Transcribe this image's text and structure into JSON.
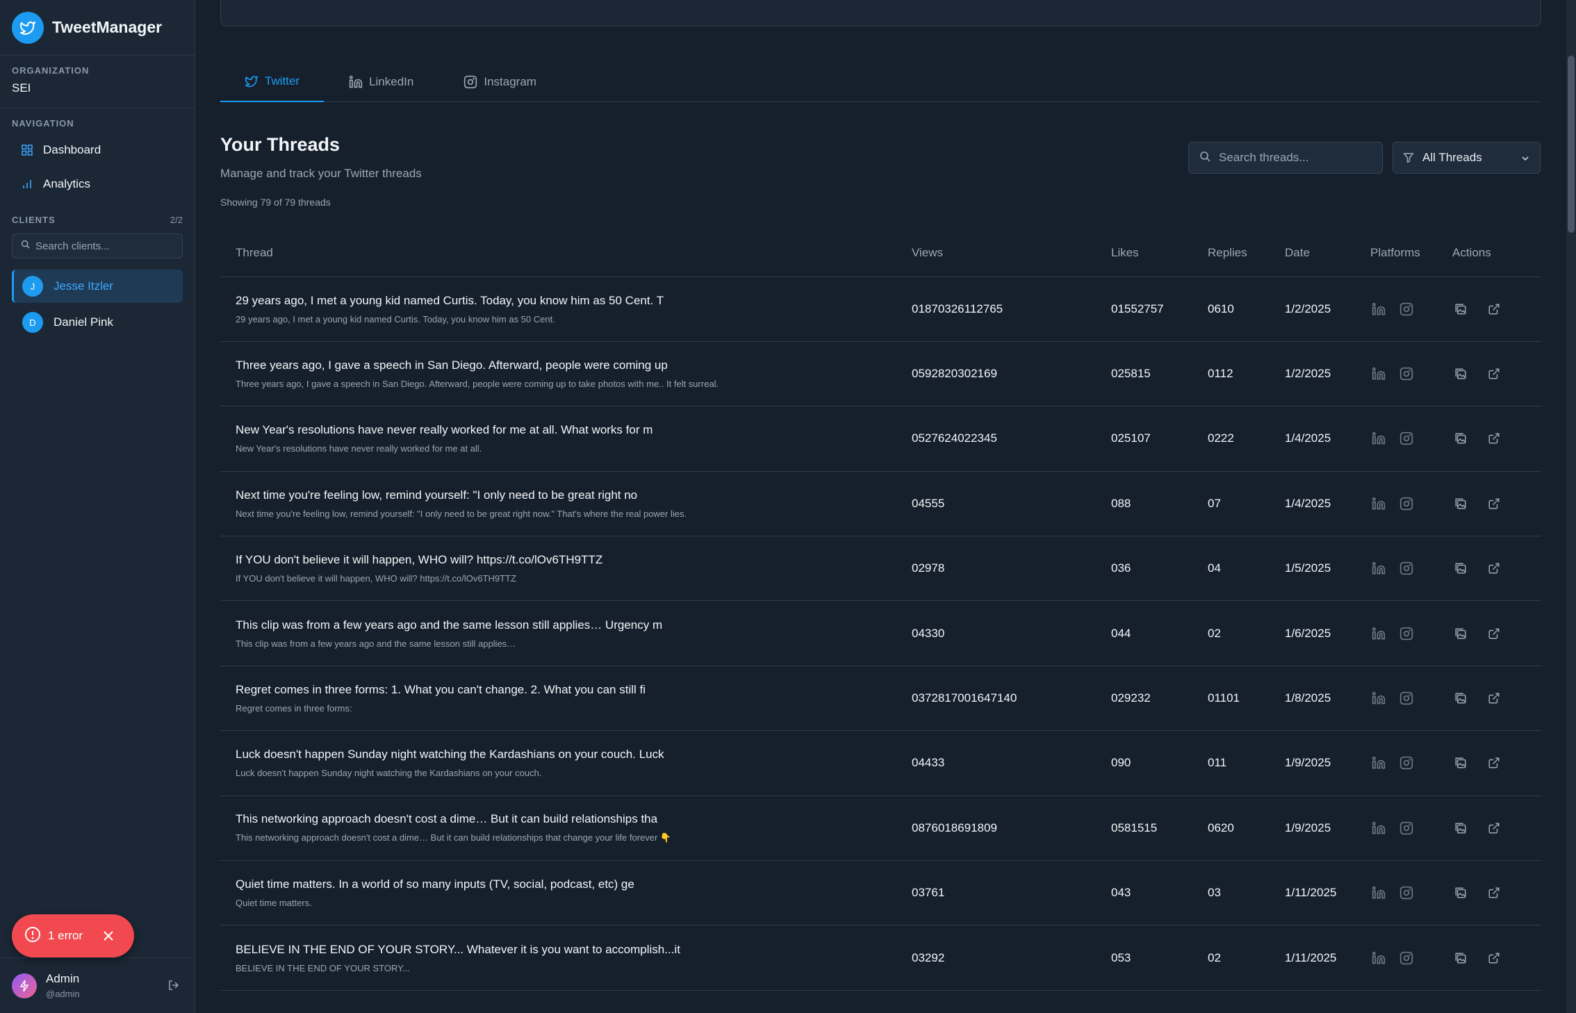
{
  "app": {
    "title": "TweetManager"
  },
  "organization": {
    "label": "ORGANIZATION",
    "name": "SEI"
  },
  "navigation": {
    "label": "NAVIGATION",
    "items": [
      {
        "label": "Dashboard",
        "icon": "dashboard-icon"
      },
      {
        "label": "Analytics",
        "icon": "bar-chart-icon"
      }
    ]
  },
  "clients": {
    "label": "CLIENTS",
    "count": "2/2",
    "search_placeholder": "Search clients...",
    "items": [
      {
        "initial": "J",
        "name": "Jesse Itzler",
        "active": true
      },
      {
        "initial": "D",
        "name": "Daniel Pink",
        "active": false
      }
    ]
  },
  "error_toast": {
    "text": "1 error"
  },
  "user": {
    "name": "Admin",
    "handle": "@admin"
  },
  "tabs": [
    {
      "label": "Twitter",
      "icon": "twitter-icon",
      "active": true
    },
    {
      "label": "LinkedIn",
      "icon": "linkedin-icon",
      "active": false
    },
    {
      "label": "Instagram",
      "icon": "instagram-icon",
      "active": false
    }
  ],
  "header": {
    "title": "Your Threads",
    "subtitle": "Manage and track your Twitter threads",
    "count": "Showing 79 of 79 threads",
    "search_placeholder": "Search threads...",
    "filter": "All Threads"
  },
  "table": {
    "columns": [
      "Thread",
      "Views",
      "Likes",
      "Replies",
      "Date",
      "Platforms",
      "Actions"
    ],
    "rows": [
      {
        "title": "29 years ago, I met a young kid named Curtis. Today, you know him as 50 Cent. T",
        "preview": "29 years ago, I met a young kid named Curtis. Today, you know him as 50 Cent.",
        "views": "01870326112765",
        "likes": "01552757",
        "replies": "0610",
        "date": "1/2/2025"
      },
      {
        "title": "Three years ago, I gave a speech in San Diego. Afterward, people were coming up",
        "preview": "Three years ago, I gave a speech in San Diego. Afterward, people were coming up to take photos with me.. It felt surreal.",
        "views": "0592820302169",
        "likes": "025815",
        "replies": "0112",
        "date": "1/2/2025"
      },
      {
        "title": "New Year's resolutions have never really worked for me at all. What works for m",
        "preview": "New Year's resolutions have never really worked for me at all.",
        "views": "0527624022345",
        "likes": "025107",
        "replies": "0222",
        "date": "1/4/2025"
      },
      {
        "title": "Next time you're feeling low, remind yourself: \"I only need to be great right no",
        "preview": "Next time you're feeling low, remind yourself: \"I only need to be great right now.\" That's where the real power lies.",
        "views": "04555",
        "likes": "088",
        "replies": "07",
        "date": "1/4/2025"
      },
      {
        "title": "If YOU don't believe it will happen, WHO will? https://t.co/lOv6TH9TTZ",
        "preview": "If YOU don't believe it will happen, WHO will? https://t.co/lOv6TH9TTZ",
        "views": "02978",
        "likes": "036",
        "replies": "04",
        "date": "1/5/2025"
      },
      {
        "title": "This clip was from a few years ago and the same lesson still applies… Urgency m",
        "preview": "This clip was from a few years ago and the same lesson still applies…",
        "views": "04330",
        "likes": "044",
        "replies": "02",
        "date": "1/6/2025"
      },
      {
        "title": "Regret comes in three forms: 1. What you can't change. 2. What you can still fi",
        "preview": "Regret comes in three forms:",
        "views": "0372817001647140",
        "likes": "029232",
        "replies": "01101",
        "date": "1/8/2025"
      },
      {
        "title": "Luck doesn't happen Sunday night watching the Kardashians on your couch. Luck",
        "preview": "Luck doesn't happen Sunday night watching the Kardashians on your couch.",
        "views": "04433",
        "likes": "090",
        "replies": "011",
        "date": "1/9/2025"
      },
      {
        "title": "This networking approach doesn't cost a dime… But it can build relationships tha",
        "preview": "This networking approach doesn't cost a dime… But it can build relationships that change your life forever 👇",
        "views": "0876018691809",
        "likes": "0581515",
        "replies": "0620",
        "date": "1/9/2025"
      },
      {
        "title": "Quiet time matters. In a world of so many inputs (TV, social, podcast, etc) ge",
        "preview": "Quiet time matters.",
        "views": "03761",
        "likes": "043",
        "replies": "03",
        "date": "1/11/2025"
      },
      {
        "title": "BELIEVE IN THE END OF YOUR STORY... Whatever it is you want to accomplish...it",
        "preview": "BELIEVE IN THE END OF YOUR STORY...",
        "views": "03292",
        "likes": "053",
        "replies": "02",
        "date": "1/11/2025"
      }
    ]
  },
  "colors": {
    "accent": "#1d9bf0",
    "background": "#16202d",
    "sidebar": "#1b2735",
    "error": "#f1494f"
  }
}
